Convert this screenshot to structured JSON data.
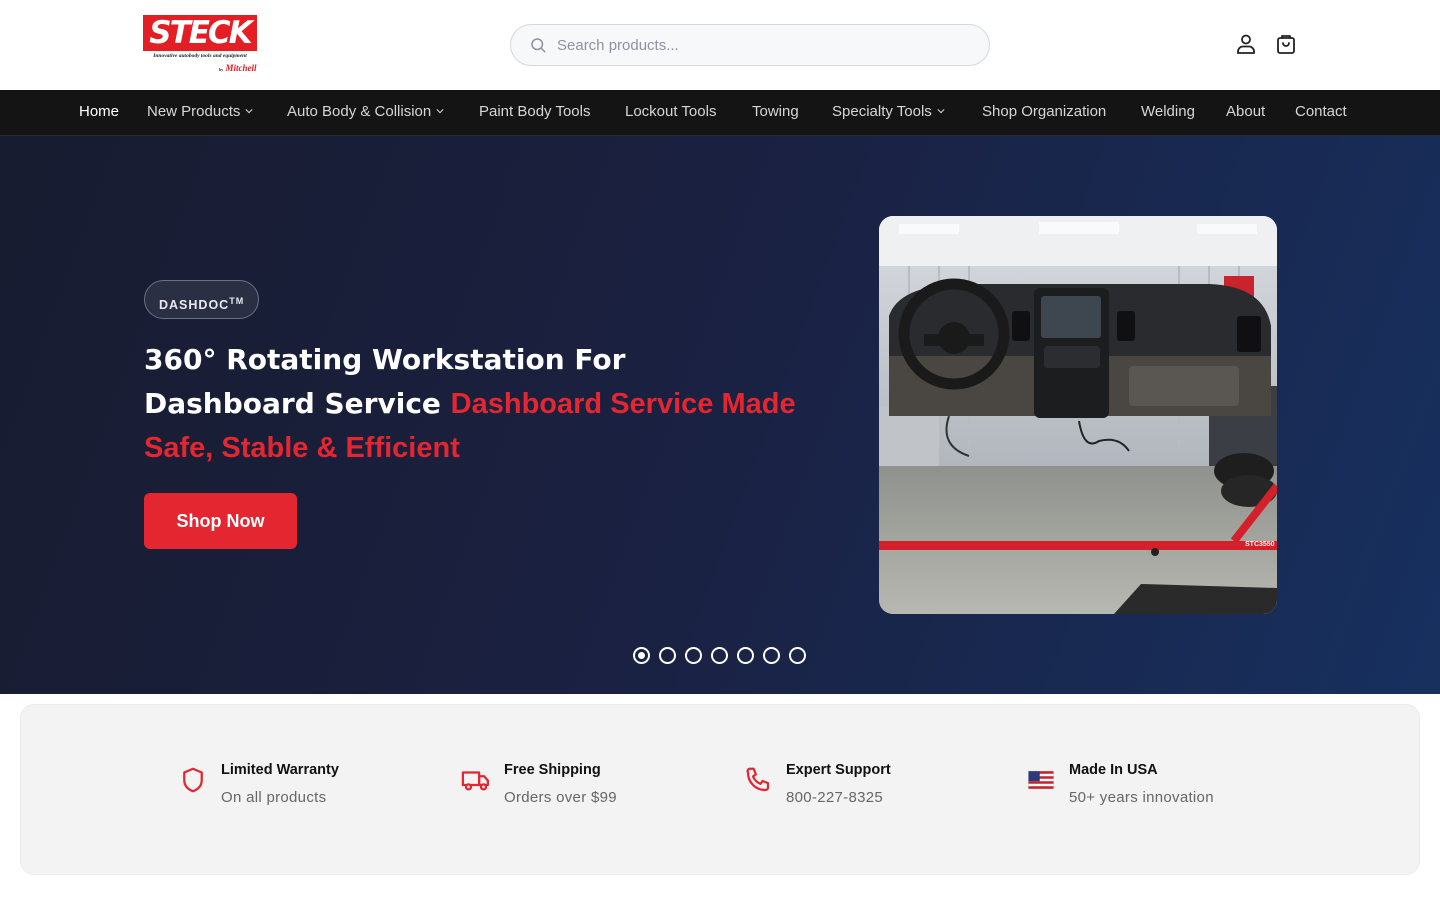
{
  "brand": {
    "name": "STECK",
    "tagline": "Innovative autobody tools and equipment",
    "by_prefix": "by",
    "by_name": "Mitchell"
  },
  "search": {
    "placeholder": "Search products..."
  },
  "header_icons": [
    "user-icon",
    "cart-icon"
  ],
  "nav": {
    "items": [
      {
        "label": "Home",
        "active": true
      },
      {
        "label": "New Products",
        "dropdown": true
      },
      {
        "label": "Auto Body & Collision",
        "dropdown": true
      },
      {
        "label": "Paint Body Tools"
      },
      {
        "label": "Lockout Tools"
      },
      {
        "label": "Towing"
      },
      {
        "label": "Specialty Tools",
        "dropdown": true
      },
      {
        "label": "Shop Organization"
      },
      {
        "label": "Welding"
      },
      {
        "label": "About"
      },
      {
        "label": "Contact"
      }
    ]
  },
  "hero": {
    "badge": "DASHDOC",
    "badge_mark": "TM",
    "title": "360° Rotating Workstation For Dashboard Service",
    "title_accent": "Dashboard Service Made Safe, Stable & Efficient",
    "cta": "Shop Now",
    "image_stamp": "STC3550",
    "slides_total": 7,
    "active_slide": 1
  },
  "features": [
    {
      "icon": "shield-icon",
      "title": "Limited Warranty",
      "subtitle": "On all products"
    },
    {
      "icon": "truck-icon",
      "title": "Free Shipping",
      "subtitle": "Orders over $99"
    },
    {
      "icon": "phone-icon",
      "title": "Expert Support",
      "subtitle": "800-227-8325"
    },
    {
      "icon": "us-flag-icon",
      "title": "Made In USA",
      "subtitle": "50+ years innovation"
    }
  ],
  "colors": {
    "brand_red": "#e3262f",
    "nav_bg": "#141414",
    "hero_dark": "#181c30",
    "hero_blue": "#17305f",
    "features_bg": "#f3f3f3"
  }
}
